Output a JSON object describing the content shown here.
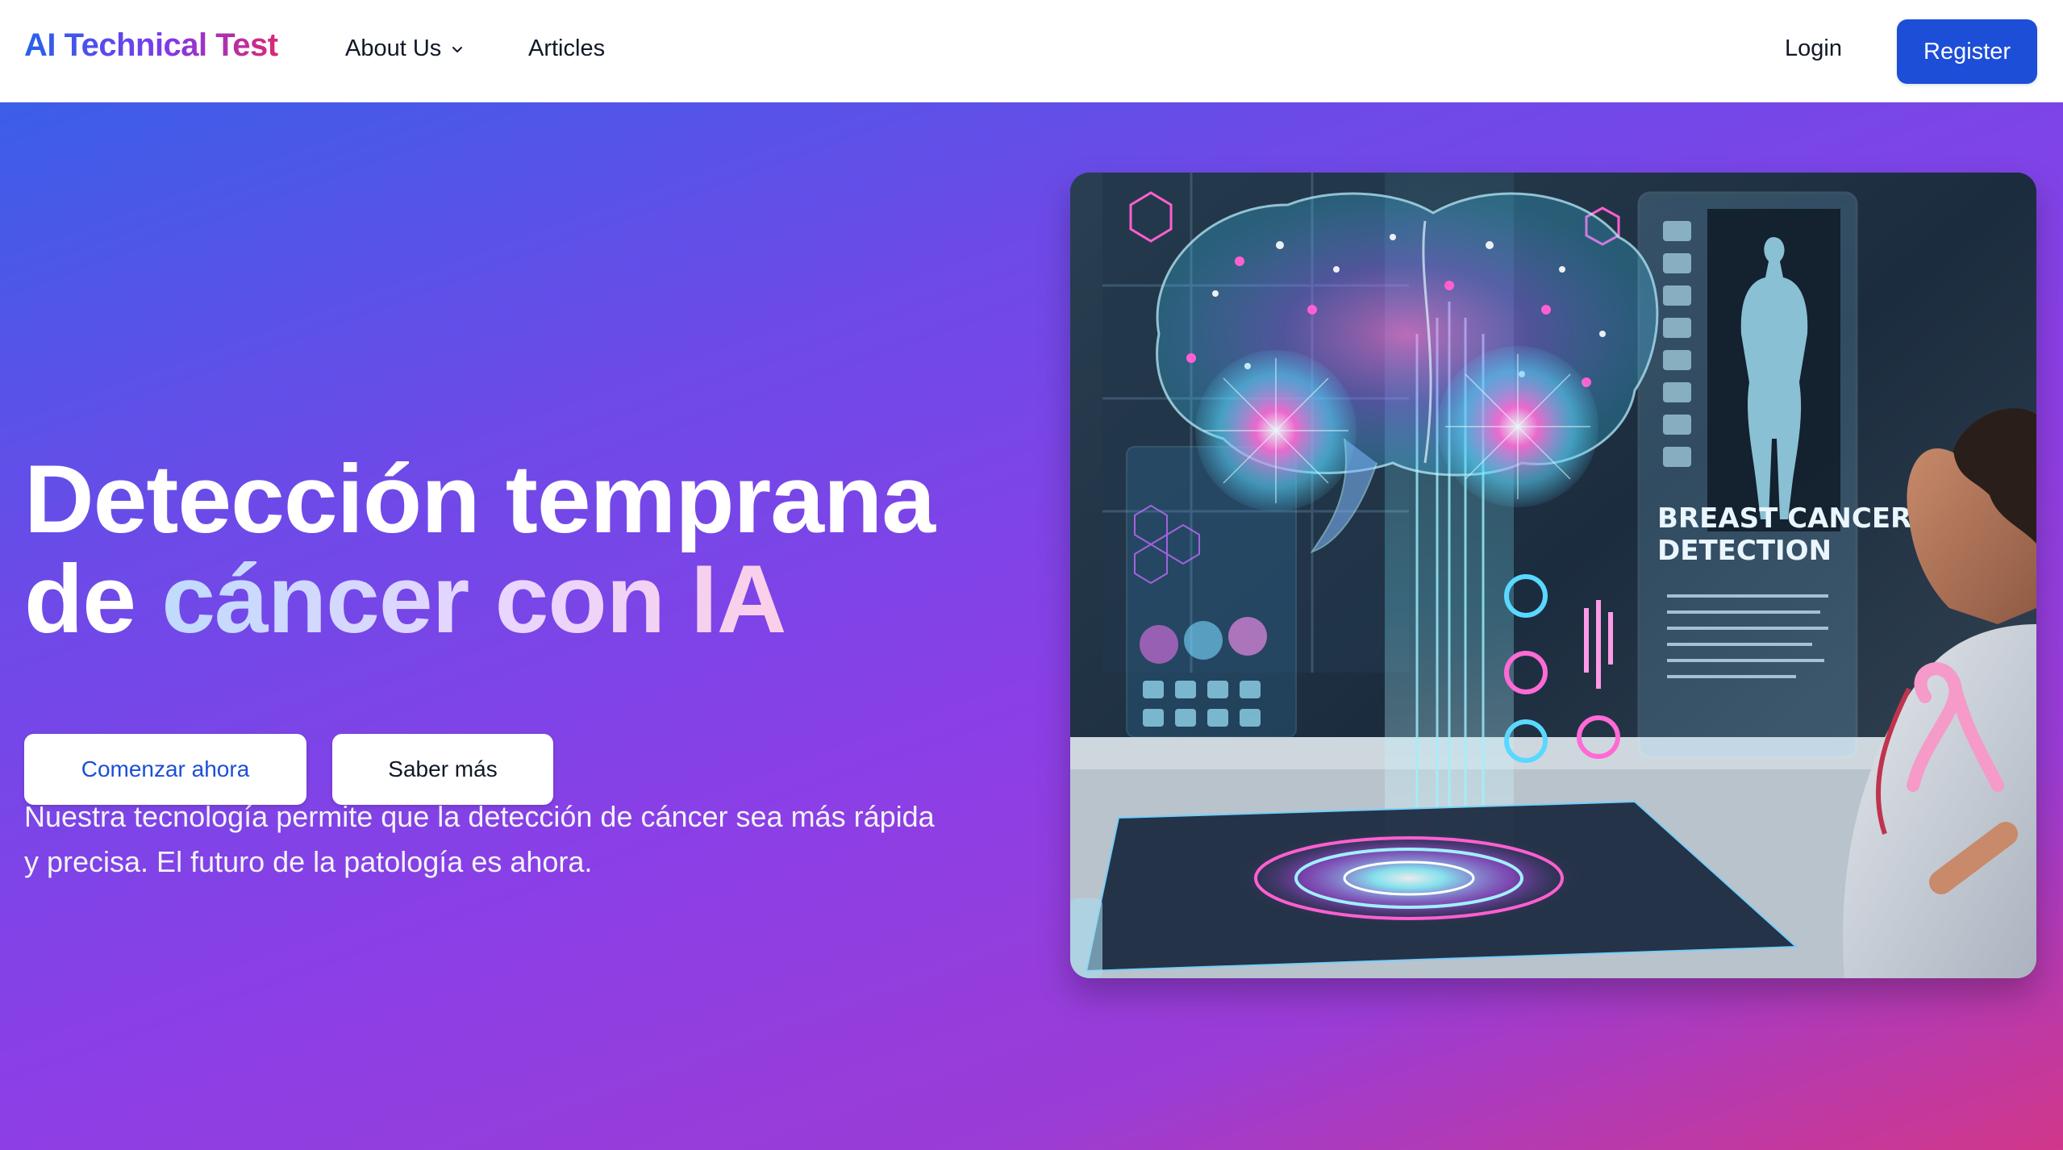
{
  "nav": {
    "brand": "AI Technical Test",
    "about_label": "About Us",
    "articles_label": "Articles",
    "login_label": "Login",
    "register_label": "Register"
  },
  "hero": {
    "title_line1": "Detección temprana",
    "title_line2_prefix": "de ",
    "title_line2_accent": "cáncer con IA",
    "subtitle": "Nuestra tecnología permite que la detección de cáncer sea más rápida y precisa. El futuro de la patología es ahora.",
    "primary_button": "Comenzar ahora",
    "secondary_button": "Saber más",
    "image": {
      "screen_text_line1": "BREAST CANCER",
      "screen_text_line2": "DETECTION"
    }
  },
  "colors": {
    "brand_gradient": [
      "#2563eb",
      "#7c3aed",
      "#db2777"
    ],
    "register_bg": "#1d4ed8",
    "hero_gradient": [
      "#3b5ee8",
      "#8b3fe6",
      "#d1378a"
    ],
    "primary_button_text": "#1d4ed8"
  },
  "icons": {
    "about_dropdown": "chevron-down-icon"
  }
}
